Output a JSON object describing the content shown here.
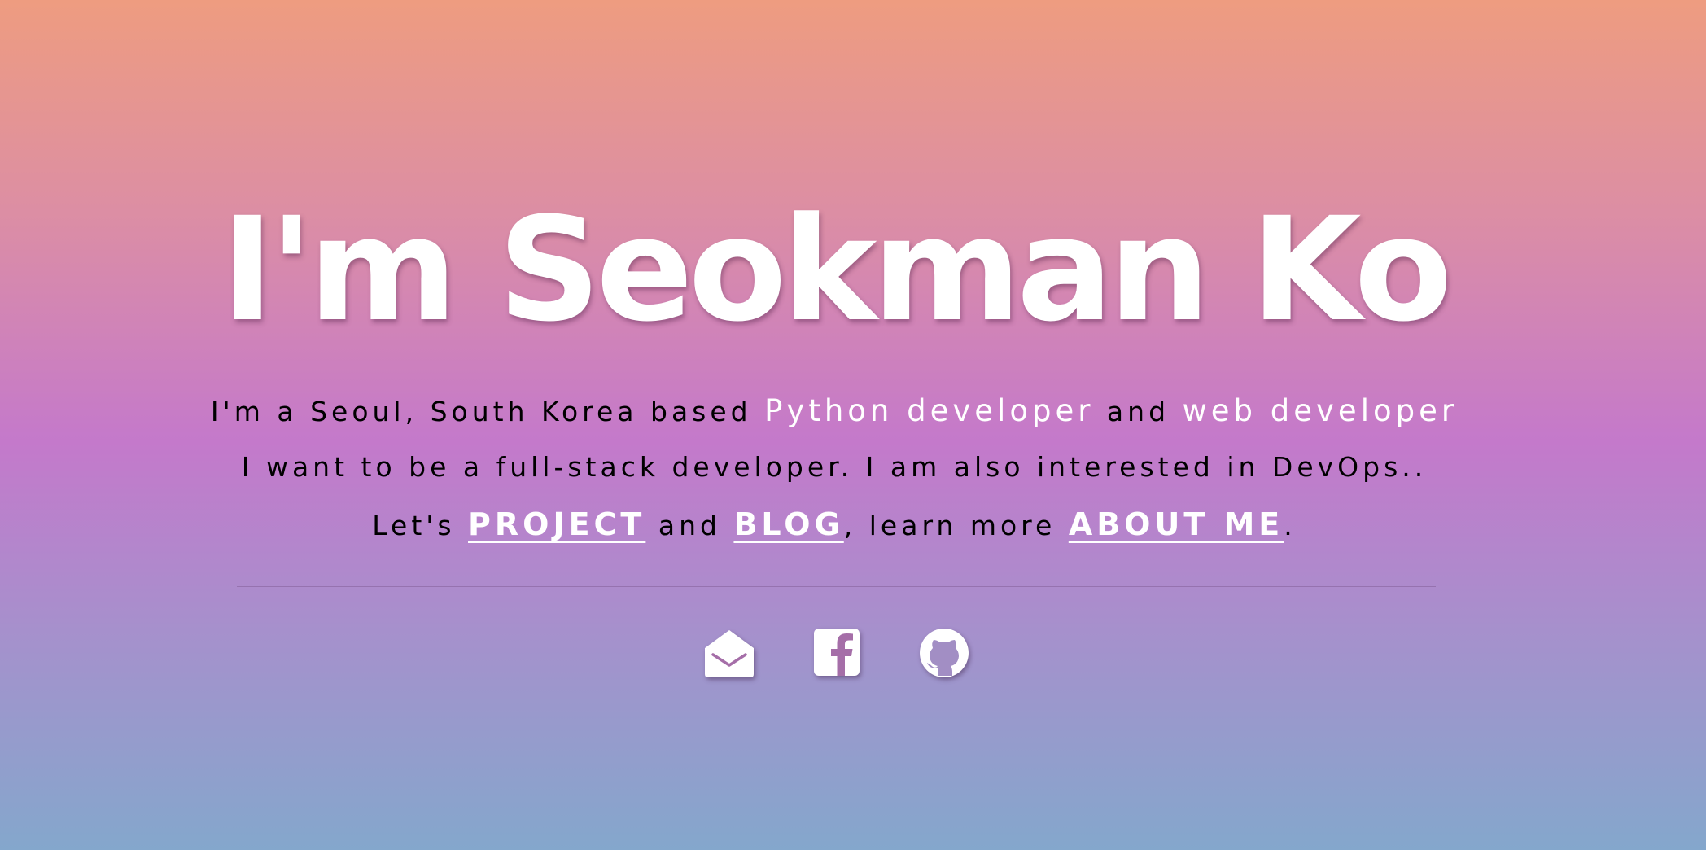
{
  "hero": {
    "title": "I'm Seokman Ko",
    "line1": {
      "prefix": "I'm a Seoul, South Korea based ",
      "highlight1": "Python developer",
      "mid": " and ",
      "highlight2": "web developer"
    },
    "line2": "I want to be a full-stack developer. I am also interested in DevOps..",
    "line3": {
      "prefix": "Let's ",
      "link_project": "PROJECT",
      "mid1": " and ",
      "link_blog": "BLOG",
      "mid2": ", learn more ",
      "link_about": "ABOUT ME",
      "suffix": "."
    }
  },
  "social": {
    "icons": [
      "mail-icon",
      "facebook-icon",
      "github-icon"
    ]
  },
  "colors": {
    "gradient_top": "#ee9c80",
    "gradient_middle": "#c479cb",
    "gradient_bottom": "#84a7cc",
    "highlight": "#ffffff",
    "text": "#000000"
  }
}
